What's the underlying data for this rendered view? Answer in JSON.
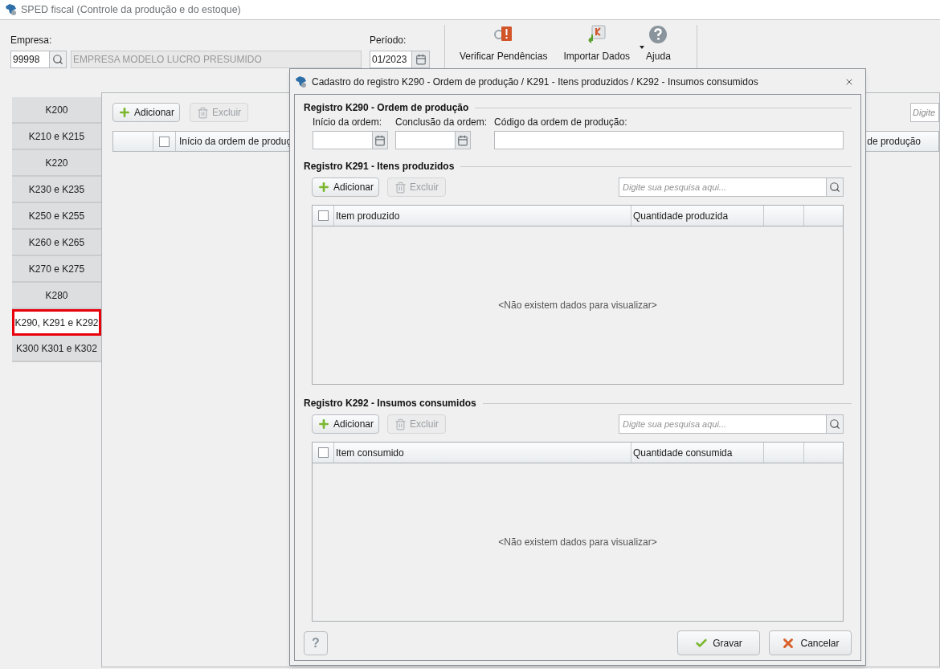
{
  "window": {
    "title": "SPED fiscal (Controle da produção e do estoque)"
  },
  "header": {
    "company_label": "Empresa:",
    "company_code": "99998",
    "company_name": "EMPRESA MODELO LUCRO PRESUMIDO",
    "period_label": "Período:",
    "period": "01/2023"
  },
  "toolbar": [
    {
      "label": "Verificar Pendências",
      "kind": "alert"
    },
    {
      "label": "Importar Dados",
      "kind": "import",
      "dropdown": true
    },
    {
      "label": "Ajuda",
      "kind": "help"
    }
  ],
  "tabs": [
    {
      "label": "K200",
      "selected": false
    },
    {
      "label": "K210 e K215",
      "selected": false
    },
    {
      "label": "K220",
      "selected": false
    },
    {
      "label": "K230 e K235",
      "selected": false
    },
    {
      "label": "K250 e K255",
      "selected": false
    },
    {
      "label": "K260 e K265",
      "selected": false
    },
    {
      "label": "K270 e K275",
      "selected": false
    },
    {
      "label": "K280",
      "selected": false
    },
    {
      "label": "K290, K291 e K292",
      "selected": true
    },
    {
      "label": "K300 K301 e K302",
      "selected": false
    }
  ],
  "main_panel": {
    "select_all": {
      "checked": false
    },
    "add_button": "Adicionar",
    "delete_button": {
      "label": "Excluir",
      "disabled": true
    },
    "search": {
      "placeholder": "Digite"
    },
    "columns": [
      "Início da ordem de produç",
      "de produção"
    ]
  },
  "dialog": {
    "title": "Cadastro do registro K290 - Ordem de produção / K291 - Itens produzidos / K292 - Insumos consumidos",
    "k290": {
      "title": "Registro K290 - Ordem de produção",
      "fields": [
        {
          "label": "Início da ordem:",
          "kind": "date"
        },
        {
          "label": "Conclusão da ordem:",
          "kind": "date"
        },
        {
          "label": "Código da ordem de produção:",
          "kind": "text"
        }
      ]
    },
    "sections": [
      {
        "title": "Registro K291 - Itens produzidos",
        "select_all": {
          "checked": false
        },
        "add_button": "Adicionar",
        "delete_button": {
          "label": "Excluir",
          "disabled": true
        },
        "search": {
          "placeholder": "Digite sua pesquisa aqui..."
        },
        "columns": [
          "Item produzido",
          "Quantidade produzida"
        ],
        "empty_message": "<Não existem dados para visualizar>"
      },
      {
        "title": "Registro K292 - Insumos consumidos",
        "select_all": {
          "checked": false
        },
        "add_button": "Adicionar",
        "delete_button": {
          "label": "Excluir",
          "disabled": true
        },
        "search": {
          "placeholder": "Digite sua pesquisa aqui..."
        },
        "columns": [
          "Item consumido",
          "Quantidade consumida"
        ],
        "empty_message": "<Não existem dados para visualizar>"
      }
    ],
    "help_button": "?",
    "buttons": [
      {
        "label": "Gravar",
        "kind": "save"
      },
      {
        "label": "Cancelar",
        "kind": "cancel"
      }
    ]
  }
}
